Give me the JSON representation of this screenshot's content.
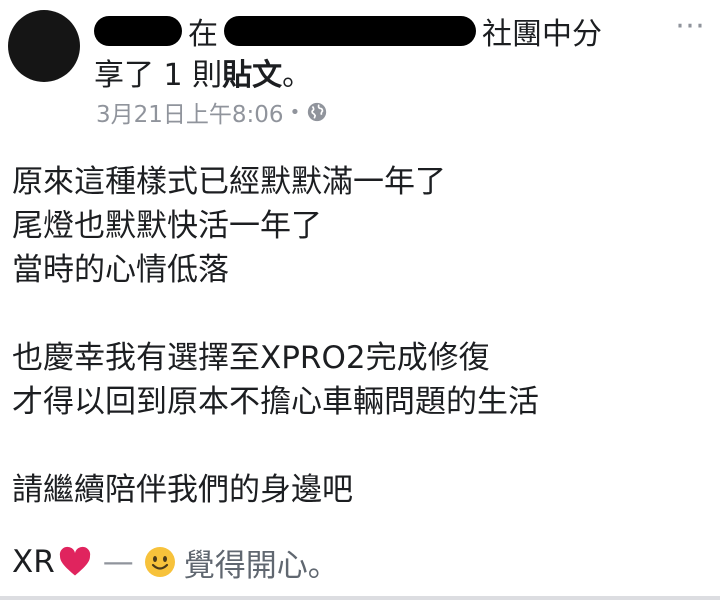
{
  "header": {
    "shared_in": "在",
    "group_suffix": "社團中分",
    "line2_prefix": "享了 1 則",
    "line2_bold": "貼文",
    "line2_suffix": "。",
    "more_icon": "⋯"
  },
  "meta": {
    "timestamp": "3月21日上午8:06",
    "separator": "•",
    "privacy_icon": "globe-icon"
  },
  "post": {
    "lines": [
      "原來這種樣式已經默默滿一年了",
      "尾燈也默默快活一年了",
      "當時的心情低落",
      "",
      "也慶幸我有選擇至XPRO2完成修復",
      "才得以回到原本不擔心車輛問題的生活",
      "",
      "請繼續陪伴我們的身邊吧",
      ""
    ]
  },
  "feeling": {
    "prefix": "XR",
    "heart_icon": "heart-icon",
    "dash": "—",
    "smiley_icon": "smiley-icon",
    "label": "覺得開心。"
  },
  "colors": {
    "text": "#1c1e21",
    "meta": "#90949c",
    "heart": "#e0245e",
    "smiley": "#f7c23b",
    "redaction": "#000000"
  }
}
